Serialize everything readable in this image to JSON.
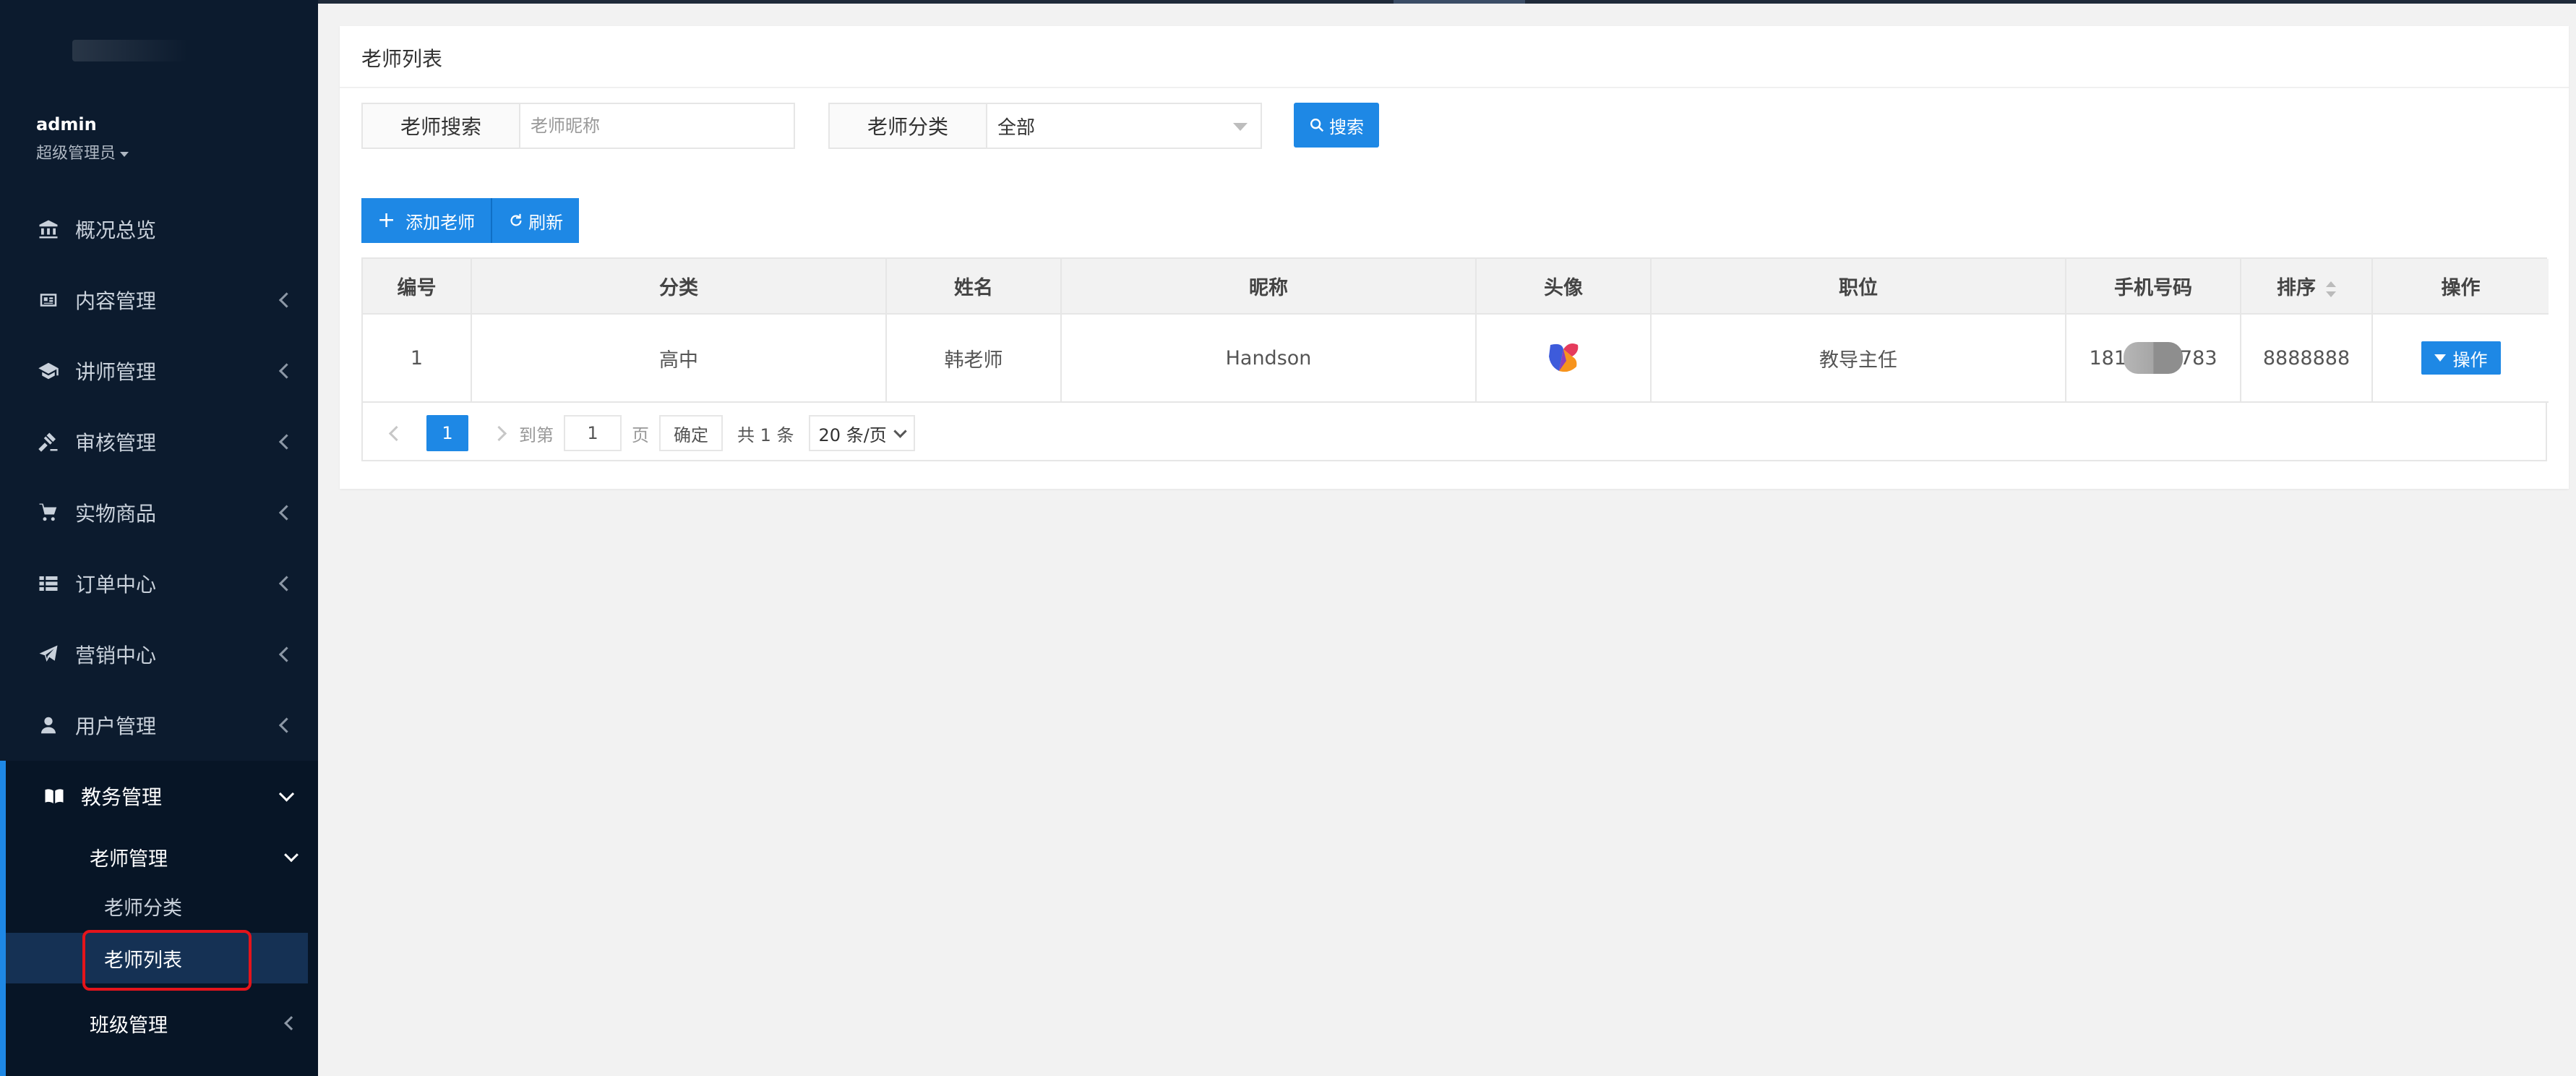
{
  "user": {
    "name": "admin",
    "role": "超级管理员"
  },
  "sidebar": {
    "items": [
      {
        "label": "概况总览",
        "icon": "bank-icon"
      },
      {
        "label": "内容管理",
        "icon": "newspaper-icon"
      },
      {
        "label": "讲师管理",
        "icon": "graduation-cap-icon"
      },
      {
        "label": "审核管理",
        "icon": "gavel-icon"
      },
      {
        "label": "实物商品",
        "icon": "cart-icon"
      },
      {
        "label": "订单中心",
        "icon": "list-icon"
      },
      {
        "label": "营销中心",
        "icon": "paper-plane-icon"
      },
      {
        "label": "用户管理",
        "icon": "user-icon"
      },
      {
        "label": "教务管理",
        "icon": "book-icon"
      }
    ],
    "submenu": {
      "group": "老师管理",
      "items": [
        "老师分类",
        "老师列表"
      ],
      "other": "班级管理"
    }
  },
  "page": {
    "title": "老师列表"
  },
  "filters": {
    "search_label": "老师搜索",
    "search_placeholder": "老师昵称",
    "category_label": "老师分类",
    "category_value": "全部",
    "search_button": "搜索"
  },
  "toolbar": {
    "add_label": "添加老师",
    "refresh_label": "刷新"
  },
  "table": {
    "columns": [
      "编号",
      "分类",
      "姓名",
      "昵称",
      "头像",
      "职位",
      "手机号码",
      "排序",
      "操作"
    ],
    "rows": [
      {
        "id": "1",
        "category": "高中",
        "name": "韩老师",
        "nickname": "Handson",
        "position": "教导主任",
        "phone_prefix": "181",
        "phone_suffix": "783",
        "sort": "8888888",
        "action": "操作"
      }
    ]
  },
  "pager": {
    "current": "1",
    "goto_label": "到第",
    "goto_value": "1",
    "page_unit": "页",
    "confirm": "确定",
    "total": "共 1 条",
    "page_size": "20 条/页"
  },
  "colors": {
    "primary": "#1e88e5",
    "sidebar_bg": "#0c1b2e",
    "highlight": "#e4141b"
  }
}
